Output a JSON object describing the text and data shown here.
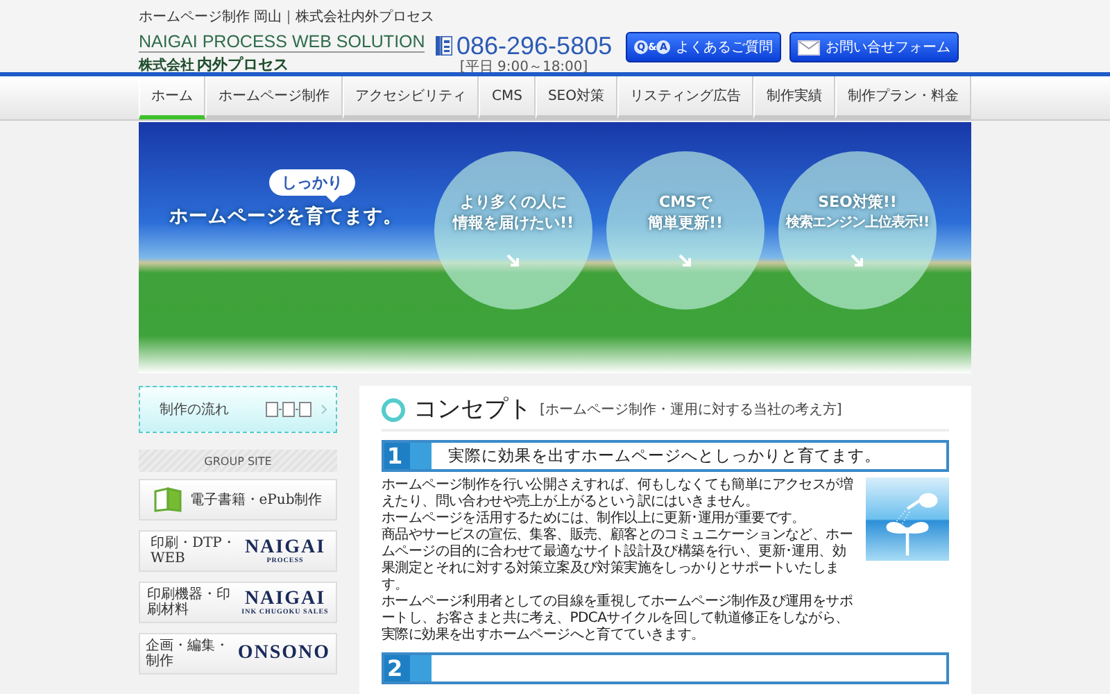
{
  "top_text": "ホームページ制作 岡山｜株式会社内外プロセス",
  "logo": {
    "title": "NAIGAI PROCESS WEB SOLUTION",
    "company_prefix": "株式会社",
    "company": "内外プロセス"
  },
  "contact": {
    "phone": "086-296-5805",
    "hours": "[平日 9:00～18:00]"
  },
  "header_buttons": [
    {
      "kind": "faq",
      "badge_q": "Q",
      "badge_amp": "&",
      "badge_a": "A",
      "label": "よくあるご質問"
    },
    {
      "kind": "mail",
      "label": "お問い合せフォーム"
    }
  ],
  "nav": [
    {
      "label": "ホーム",
      "selected": true
    },
    {
      "label": "ホームページ制作",
      "selected": false
    },
    {
      "label": "アクセシビリティ",
      "selected": false
    },
    {
      "label": "CMS",
      "selected": false
    },
    {
      "label": "SEO対策",
      "selected": false
    },
    {
      "label": "リスティング広告",
      "selected": false
    },
    {
      "label": "制作実績",
      "selected": false
    },
    {
      "label": "制作プラン・料金",
      "selected": false
    }
  ],
  "hero": {
    "bubble": "しっかり",
    "tagline": "ホームページを育てます。",
    "circles": [
      {
        "lines": [
          "より多くの人に",
          "情報を届けたい!!"
        ]
      },
      {
        "lines": [
          "CMSで",
          "簡単更新!!"
        ]
      },
      {
        "lines": [
          "SEO対策!!",
          "検索エンジン上位表示!!"
        ]
      }
    ]
  },
  "sidebar": {
    "flow_button": "制作の流れ",
    "group_heading": "GROUP SITE",
    "group_sites": [
      {
        "kind": "ebook",
        "label": "電子書籍・ePub制作"
      },
      {
        "kind": "logo",
        "label": "印刷・DTP・WEB",
        "logo": "NAIGAI",
        "logo_sub": "PROCESS"
      },
      {
        "kind": "logo",
        "label": "印刷機器・印刷材料",
        "logo": "NAIGAI",
        "logo_sub": "INK CHUGOKU SALES"
      },
      {
        "kind": "logo",
        "label": "企画・編集・制作",
        "logo": "ONSONO"
      }
    ]
  },
  "main": {
    "title": "コンセプト",
    "subtitle": "[ホームページ制作・運用に対する当社の考え方]",
    "sections": [
      {
        "number": "1",
        "heading": "実際に効果を出すホームページへとしっかりと育てます。",
        "paragraphs": [
          "ホームページ制作を行い公開さえすれば、何もしなくても簡単にアクセスが増えたり、問い合わせや売上が上がるという訳にはいきません。",
          "ホームページを活用するためには、制作以上に更新･運用が重要です。",
          "商品やサービスの宣伝、集客、販売、顧客とのコミュニケーションなど、ホームページの目的に合わせて最適なサイト設計及び構築を行い、更新･運用、効果測定とそれに対する対策立案及び対策実施をしっかりとサポートいたします。",
          "ホームページ利用者としての目線を重視してホームページ制作及び運用をサポートし、お客さまと共に考え、PDCAサイクルを回して軌道修正をしながら、実際に効果を出すホームページへと育てていきます。"
        ]
      },
      {
        "number": "2"
      }
    ]
  }
}
